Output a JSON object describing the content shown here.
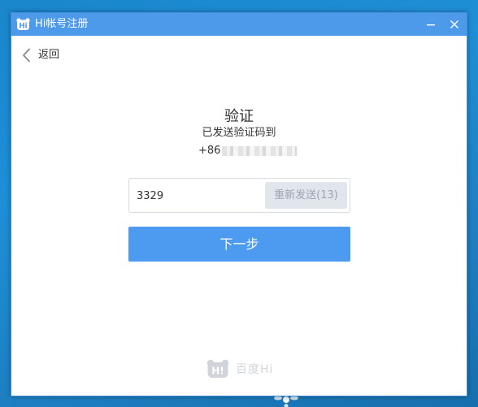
{
  "window": {
    "title": "Hi帐号注册",
    "logo_icon": "hi-bear-logo-icon",
    "minimize_icon": "minimize-icon",
    "close_icon": "close-icon",
    "titlebar_color": "#4c9ae9"
  },
  "nav": {
    "back_label": "返回",
    "back_icon": "chevron-left-icon"
  },
  "verify": {
    "heading": "验证",
    "sub_heading": "已发送验证码到",
    "phone_prefix": "+86"
  },
  "code_field": {
    "value": "3329",
    "resend_label": "重新发送(13)"
  },
  "actions": {
    "next_label": "下一步",
    "next_color": "#4c9bf0"
  },
  "footer": {
    "brand_label": "百度Hi",
    "brand_icon": "hi-bear-logo-icon"
  }
}
